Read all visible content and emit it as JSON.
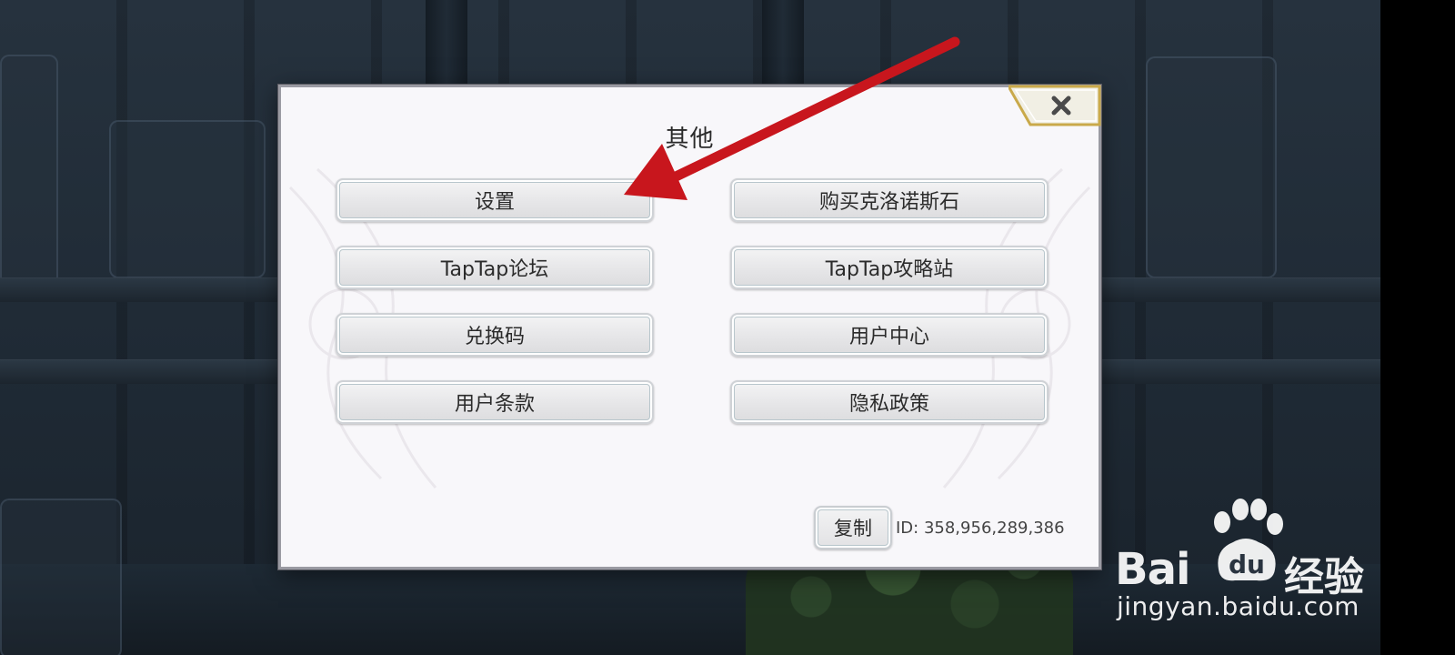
{
  "dialog": {
    "title": "其他",
    "close_icon": "close-x-icon",
    "buttons": {
      "settings": "设置",
      "buy_chronos": "购买克洛诺斯石",
      "taptap_forum": "TapTap论坛",
      "taptap_guide": "TapTap攻略站",
      "redeem_code": "兑换码",
      "user_center": "用户中心",
      "user_terms": "用户条款",
      "privacy_policy": "隐私政策"
    },
    "copy_label": "复制",
    "player_id": "ID: 358,956,289,386"
  },
  "annotation": {
    "arrow_color": "#c8161d",
    "arrow_target": "settings"
  },
  "watermark": {
    "brand_latin": "Bai",
    "brand_paw_text": "du",
    "brand_cn": "经验",
    "url": "jingyan.baidu.com",
    "paw_icon": "baidu-paw-icon"
  },
  "colors": {
    "dialog_bg": "#f8f7fa",
    "button_border": "#b8c6cc",
    "close_gold": "#c9a94a"
  }
}
